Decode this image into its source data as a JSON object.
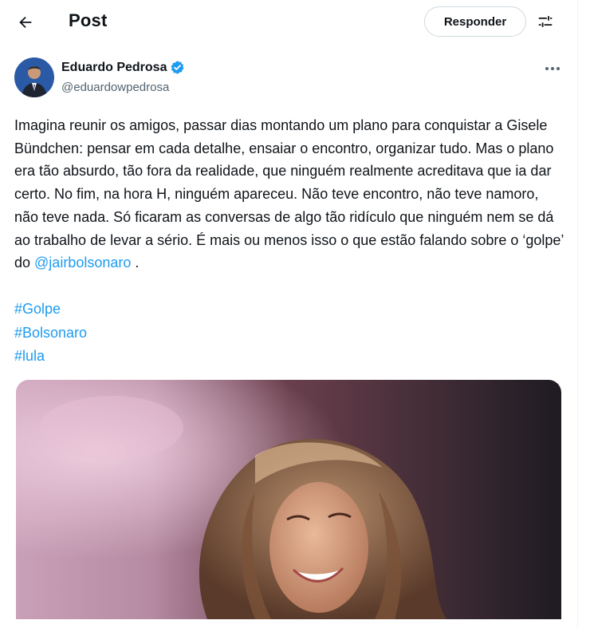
{
  "header": {
    "title": "Post",
    "reply_label": "Responder"
  },
  "author": {
    "name": "Eduardo Pedrosa",
    "handle": "@eduardowpedrosa",
    "verified": true
  },
  "post": {
    "text_before_mention": "Imagina reunir os amigos, passar dias montando um plano para conquistar a Gisele Bündchen: pensar em cada detalhe, ensaiar o encontro, organizar tudo. Mas o plano era tão absurdo, tão fora da realidade, que ninguém realmente acreditava que ia dar certo. No fim, na hora H, ninguém apareceu. Não teve encontro, não teve namoro, não teve nada. Só ficaram as conversas de algo tão ridículo que ninguém nem se dá ao trabalho de levar a sério. É mais ou menos isso o que estão falando sobre o ‘golpe’ do ",
    "mention": "@jairbolsonaro",
    "text_after_mention": " .",
    "hashtags": [
      "#Golpe",
      "#Bolsonaro",
      "#lula"
    ]
  },
  "colors": {
    "accent": "#1d9bf0",
    "text": "#0f1419",
    "secondary_text": "#536471",
    "border": "#cfd9de"
  },
  "icons": {
    "back": "arrow-left-icon",
    "settings": "sliders-icon",
    "verified": "verified-badge-icon",
    "more": "more-horizontal-icon"
  }
}
